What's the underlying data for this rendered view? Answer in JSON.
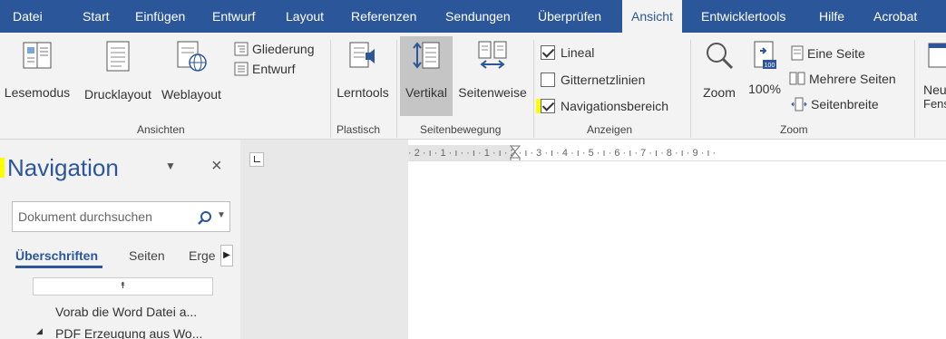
{
  "tabs": [
    "Datei",
    "Start",
    "Einfügen",
    "Entwurf",
    "Layout",
    "Referenzen",
    "Sendungen",
    "Überprüfen",
    "Ansicht",
    "Entwicklertools",
    "Hilfe",
    "Acrobat"
  ],
  "active_tab": "Ansicht",
  "groups": {
    "ansichten": {
      "label": "Ansichten",
      "lesemodus": "Lesemodus",
      "drucklayout": "Drucklayout",
      "weblayout": "Weblayout",
      "gliederung": "Gliederung",
      "entwurf": "Entwurf"
    },
    "plastisch": {
      "label": "Plastisch",
      "lerntools": "Lerntools"
    },
    "seitenbewegung": {
      "label": "Seitenbewegung",
      "vertikal": "Vertikal",
      "seitenweise": "Seitenweise"
    },
    "anzeigen": {
      "label": "Anzeigen",
      "lineal": "Lineal",
      "gitternetzlinien": "Gitternetzlinien",
      "navigationsbereich": "Navigationsbereich",
      "lineal_checked": true,
      "gitternetzlinien_checked": false,
      "navigationsbereich_checked": true
    },
    "zoom": {
      "label": "Zoom",
      "zoom": "Zoom",
      "hundred": "100%",
      "badge": "100",
      "eine_seite": "Eine Seite",
      "mehrere_seiten": "Mehrere Seiten",
      "seitenbreite": "Seitenbreite"
    },
    "fenster": {
      "neu_line1": "Neu",
      "neu_line2": "Fens"
    }
  },
  "navigation": {
    "title": "Navigation",
    "search_placeholder": "Dokument durchsuchen",
    "tabs": [
      "Überschriften",
      "Seiten",
      "Erge"
    ],
    "items": [
      "Vorab die Word Datei a...",
      "PDF Erzeugung aus Wo..."
    ]
  },
  "ruler_text": "· 2 · ı · 1 · ı ·   · ı · 1 · ı · 2 · ı · 3 · ı · 4 · ı · 5 · ı · 6 · ı · 7 · ı · 8 · ı · 9 · ı ·",
  "colors": {
    "accent": "#2b579a",
    "highlight": "#ffff00"
  }
}
